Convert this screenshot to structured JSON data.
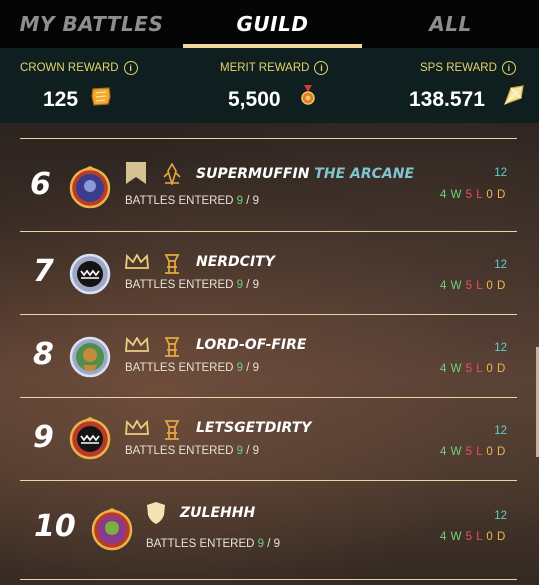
{
  "tabs": [
    {
      "label": "MY BATTLES",
      "active": false
    },
    {
      "label": "GUILD",
      "active": true
    },
    {
      "label": "ALL",
      "active": false
    }
  ],
  "rewards": {
    "crown": {
      "label": "CROWN REWARD",
      "value": "125",
      "icon": "crown-token-icon"
    },
    "merit": {
      "label": "MERIT REWARD",
      "value": "5,500",
      "icon": "merit-medal-icon"
    },
    "sps": {
      "label": "SPS REWARD",
      "value": "138.571",
      "icon": "sps-crystal-icon"
    }
  },
  "entered_label": "BATTLES ENTERED",
  "players": [
    {
      "rank": "6",
      "name": "SUPERMUFFIN",
      "title": "THE ARCANE",
      "entered": "9",
      "total": "9",
      "score": "12",
      "w": "4",
      "l": "5",
      "d": "0",
      "role": "banner-icon",
      "league": "league-icon"
    },
    {
      "rank": "7",
      "name": "NERDCITY",
      "title": "",
      "entered": "9",
      "total": "9",
      "score": "12",
      "w": "4",
      "l": "5",
      "d": "0",
      "role": "crown-icon",
      "league": "league-icon"
    },
    {
      "rank": "8",
      "name": "LORD-OF-FIRE",
      "title": "",
      "entered": "9",
      "total": "9",
      "score": "12",
      "w": "4",
      "l": "5",
      "d": "0",
      "role": "crown-icon",
      "league": "league-icon"
    },
    {
      "rank": "9",
      "name": "LETSGETDIRTY",
      "title": "",
      "entered": "9",
      "total": "9",
      "score": "12",
      "w": "4",
      "l": "5",
      "d": "0",
      "role": "crown-icon",
      "league": "league-icon"
    },
    {
      "rank": "10",
      "name": "ZULEHHH",
      "title": "",
      "entered": "9",
      "total": "9",
      "score": "12",
      "w": "4",
      "l": "5",
      "d": "0",
      "role": "shield-icon",
      "league": ""
    }
  ],
  "colors": {
    "accent": "#efd79e",
    "win": "#6dd37a",
    "loss": "#f04e5e",
    "draw": "#f0b84a",
    "score": "#5fd1c4",
    "reward_label": "#e2d46a"
  }
}
